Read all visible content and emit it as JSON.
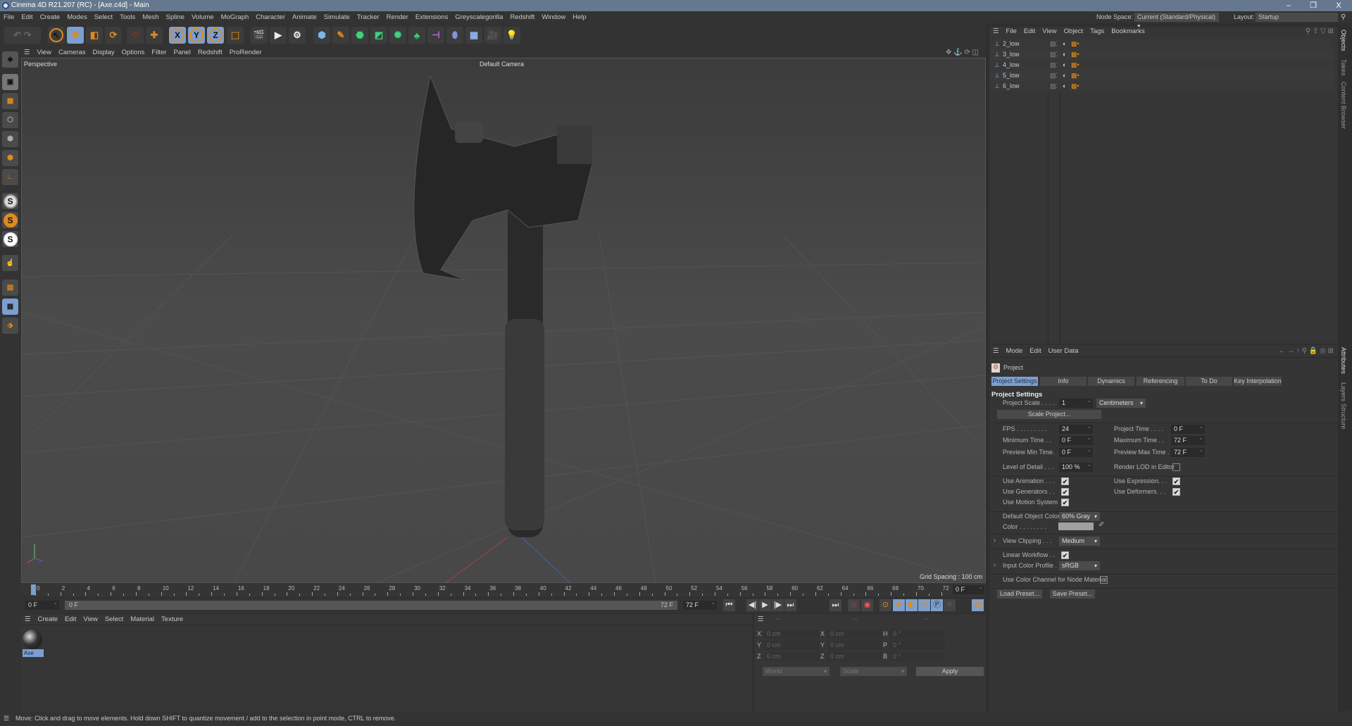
{
  "title": "Cinema 4D R21.207 (RC) - [Axe.c4d] - Main",
  "window_controls": {
    "minimize": "–",
    "maximize": "❐",
    "close": "X"
  },
  "menu": [
    "File",
    "Edit",
    "Create",
    "Modes",
    "Select",
    "Tools",
    "Mesh",
    "Spline",
    "Volume",
    "MoGraph",
    "Character",
    "Animate",
    "Simulate",
    "Tracker",
    "Render",
    "Extensions",
    "Greyscalegorilla",
    "Redshift",
    "Window",
    "Help"
  ],
  "node_space": {
    "label": "Node Space:",
    "value": "Current (Standard/Physical)"
  },
  "layout": {
    "label": "Layout:",
    "value": "Startup"
  },
  "toolbar": {
    "axis_x": "X",
    "axis_y": "Y",
    "axis_z": "Z"
  },
  "left_tools": {
    "s1": "S",
    "s2": "S",
    "s3": "S"
  },
  "viewport_menu": [
    "View",
    "Cameras",
    "Display",
    "Options",
    "Filter",
    "Panel",
    "Redshift",
    "ProRender"
  ],
  "viewport": {
    "view_name": "Perspective",
    "camera": "Default Camera",
    "grid_spacing": "Grid Spacing : 100 cm"
  },
  "timeline": {
    "start": 0,
    "end": 72,
    "step": 2,
    "current_frame": "0 F",
    "field_start": "0 F",
    "range_start": "0 F",
    "range_end": "72 F",
    "field_end": "72 F"
  },
  "playback": {
    "first": "⏮",
    "prev_key": "◀|",
    "play": "▶",
    "next_key": "|▶",
    "last": "⏭",
    "end": "⏭"
  },
  "material_menu": [
    "Create",
    "Edit",
    "View",
    "Select",
    "Material",
    "Texture"
  ],
  "materials": [
    {
      "name": "Axe"
    }
  ],
  "coordinates": {
    "menu": [
      "--",
      "--",
      "--"
    ],
    "rows": [
      {
        "a": "X",
        "v1": "0 cm",
        "b": "X",
        "v2": "0 cm",
        "c": "H",
        "v3": "0 °"
      },
      {
        "a": "Y",
        "v1": "0 cm",
        "b": "Y",
        "v2": "0 cm",
        "c": "P",
        "v3": "0 °"
      },
      {
        "a": "Z",
        "v1": "0 cm",
        "b": "Z",
        "v2": "0 cm",
        "c": "B",
        "v3": "0 °"
      }
    ],
    "space": "World",
    "mode": "Scale",
    "apply": "Apply"
  },
  "status": "Move: Click and drag to move elements. Hold down SHIFT to quantize movement / add to the selection in point mode, CTRL to remove.",
  "object_manager": {
    "menu": [
      "File",
      "Edit",
      "View",
      "Object",
      "Tags",
      "Bookmarks"
    ],
    "objects": [
      {
        "name": "2_low"
      },
      {
        "name": "3_low"
      },
      {
        "name": "4_low"
      },
      {
        "name": "5_low"
      },
      {
        "name": "6_low"
      }
    ]
  },
  "side_tabs": [
    "Objects",
    "Takes",
    "Content Browser",
    "Attributes",
    "Layers",
    "Structure"
  ],
  "attributes": {
    "menu": [
      "Mode",
      "Edit",
      "User Data"
    ],
    "object": "Project",
    "tabs": [
      "Project Settings",
      "Info",
      "Dynamics",
      "Referencing",
      "To Do",
      "Key Interpolation"
    ],
    "section": "Project Settings",
    "project_scale": {
      "label": "Project Scale . . . .",
      "value": "1",
      "unit": "Centimeters"
    },
    "scale_project": "Scale Project...",
    "fps": {
      "label": "FPS . . . . . . . . .",
      "value": "24"
    },
    "project_time": {
      "label": "Project Time . . . .",
      "value": "0 F"
    },
    "min_time": {
      "label": "Minimum Time . .",
      "value": "0 F"
    },
    "max_time": {
      "label": "Maximum Time . .",
      "value": "72 F"
    },
    "preview_min": {
      "label": "Preview Min Time.",
      "value": "0 F"
    },
    "preview_max": {
      "label": "Preview Max Time .",
      "value": "72 F"
    },
    "lod": {
      "label": "Level of Detail . . .",
      "value": "100 %"
    },
    "render_lod": {
      "label": "Render LOD in Editor",
      "checked": false
    },
    "use_animation": {
      "label": "Use Animation . . .",
      "checked": true
    },
    "use_expression": {
      "label": "Use Expression. . .",
      "checked": true
    },
    "use_generators": {
      "label": "Use Generators . .",
      "checked": true
    },
    "use_deformers": {
      "label": "Use Deformers. . .",
      "checked": true
    },
    "use_motion": {
      "label": "Use Motion System",
      "checked": true
    },
    "default_color": {
      "label": "Default Object Color",
      "value": "60% Gray"
    },
    "color": {
      "label": "Color . . . . . . . .",
      "swatch": "#a0a0a0"
    },
    "view_clipping": {
      "label": "View Clipping . . .",
      "value": "Medium"
    },
    "linear_workflow": {
      "label": "Linear Workflow . .",
      "checked": true
    },
    "input_profile": {
      "label": "Input Color Profile .",
      "value": "sRGB"
    },
    "color_channel": {
      "label": "Use Color Channel for Node Material",
      "checked": false
    },
    "load_preset": "Load Preset...",
    "save_preset": "Save Preset..."
  },
  "colors": {
    "accent": "#7d9fd0",
    "orange": "#e08a1c",
    "title": "#66788f"
  }
}
